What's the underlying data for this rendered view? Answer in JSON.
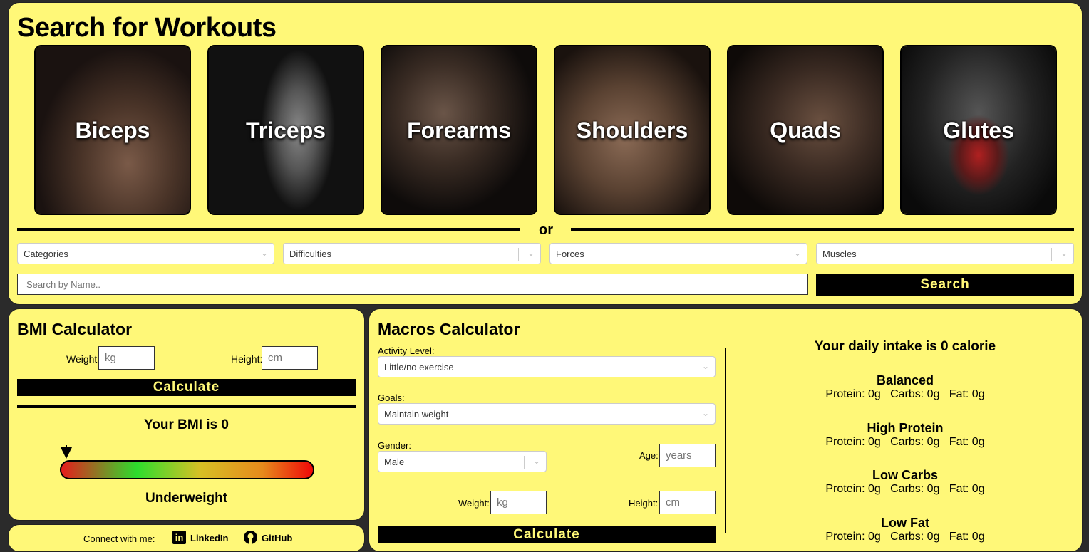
{
  "search": {
    "title": "Search for Workouts",
    "cards": [
      {
        "label": "Biceps"
      },
      {
        "label": "Triceps"
      },
      {
        "label": "Forearms"
      },
      {
        "label": "Shoulders"
      },
      {
        "label": "Quads"
      },
      {
        "label": "Glutes"
      }
    ],
    "or_text": "or",
    "filters": {
      "categories": "Categories",
      "difficulties": "Difficulties",
      "forces": "Forces",
      "muscles": "Muscles"
    },
    "name_placeholder": "Search by Name..",
    "search_label": "Search"
  },
  "bmi": {
    "title": "BMI Calculator",
    "weight_label": "Weight:",
    "weight_placeholder": "kg",
    "height_label": "Height:",
    "height_placeholder": "cm",
    "calculate_label": "Calculate",
    "result": "Your BMI is 0",
    "category": "Underweight"
  },
  "social": {
    "connect_text": "Connect with me:",
    "linkedin": "LinkedIn",
    "github": "GitHub"
  },
  "macros": {
    "title": "Macros Calculator",
    "activity_label": "Activity Level:",
    "activity_value": "Little/no exercise",
    "goals_label": "Goals:",
    "goals_value": "Maintain weight",
    "gender_label": "Gender:",
    "gender_value": "Male",
    "age_label": "Age:",
    "age_placeholder": "years",
    "weight_label": "Weight:",
    "weight_placeholder": "kg",
    "height_label": "Height:",
    "height_placeholder": "cm",
    "calculate_label": "Calculate",
    "intake": "Your daily intake is 0 calorie",
    "diets": [
      {
        "name": "Balanced",
        "values": "Protein: 0g   Carbs: 0g   Fat: 0g"
      },
      {
        "name": "High Protein",
        "values": "Protein: 0g   Carbs: 0g   Fat: 0g"
      },
      {
        "name": "Low Carbs",
        "values": "Protein: 0g   Carbs: 0g   Fat: 0g"
      },
      {
        "name": "Low Fat",
        "values": "Protein: 0g   Carbs: 0g   Fat: 0g"
      }
    ]
  },
  "colors": {
    "panel": "#fff878",
    "background": "#2b2b2b",
    "button": "#000000",
    "button_text": "#fff878"
  }
}
